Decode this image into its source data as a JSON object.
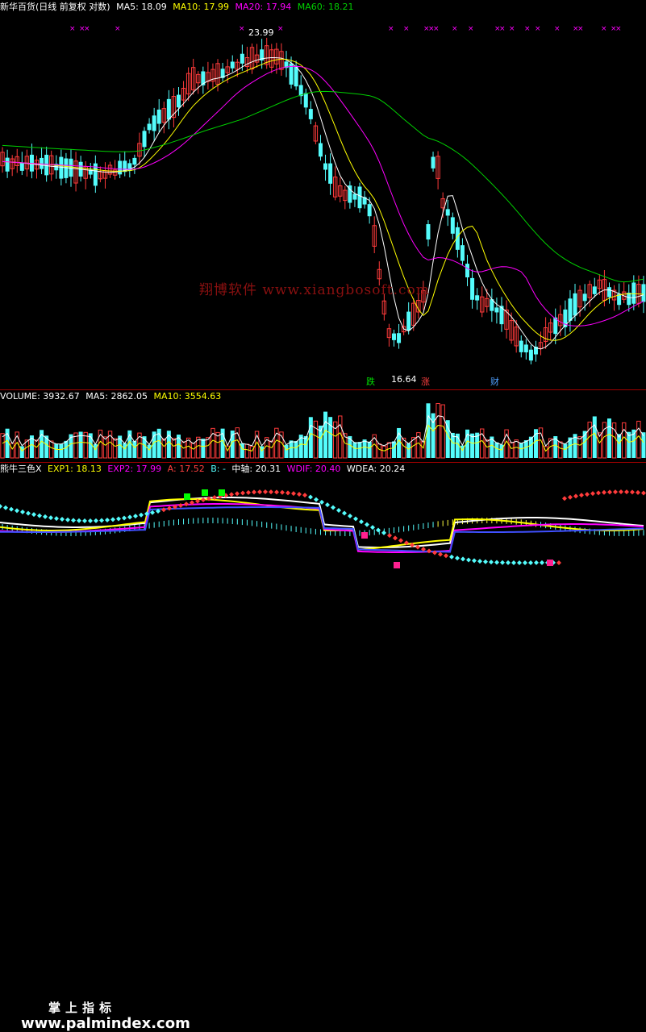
{
  "price_header": {
    "title": "新华百货(日线 前复权 对数)",
    "ma5": "MA5: 18.09",
    "ma10": "MA10: 17.99",
    "ma20": "MA20: 17.94",
    "ma60": "MA60: 18.21"
  },
  "price_annotations": {
    "high_label": "23.99",
    "low_label": "16.64",
    "marker_die": "跌",
    "marker_zhang": "涨",
    "marker_cai": "财"
  },
  "volume_header": {
    "volume": "VOLUME: 3932.67",
    "ma5": "MA5: 2862.05",
    "ma10": "MA10: 3554.63"
  },
  "indicator_header": {
    "name": "熊牛三色X",
    "exp1": "EXP1: 18.13",
    "exp2": "EXP2: 17.99",
    "a": "A: 17.52",
    "b": "B: -",
    "axis": "中轴: 20.31",
    "wdif": "WDIF: 20.40",
    "wdea": "WDEA: 20.24"
  },
  "watermark": "翔博软件 www.xiangbosoft.com",
  "branding": {
    "cn": "掌上指标",
    "url": "www.palmindex.com"
  },
  "colors": {
    "up": "#ff3b3b",
    "down": "#54fcfc",
    "ma5": "#ffffff",
    "ma10": "#ffff00",
    "ma20": "#ff00ff",
    "ma60": "#00d000",
    "divider": "#a00000",
    "marker_x": "#ff00ff"
  }
}
